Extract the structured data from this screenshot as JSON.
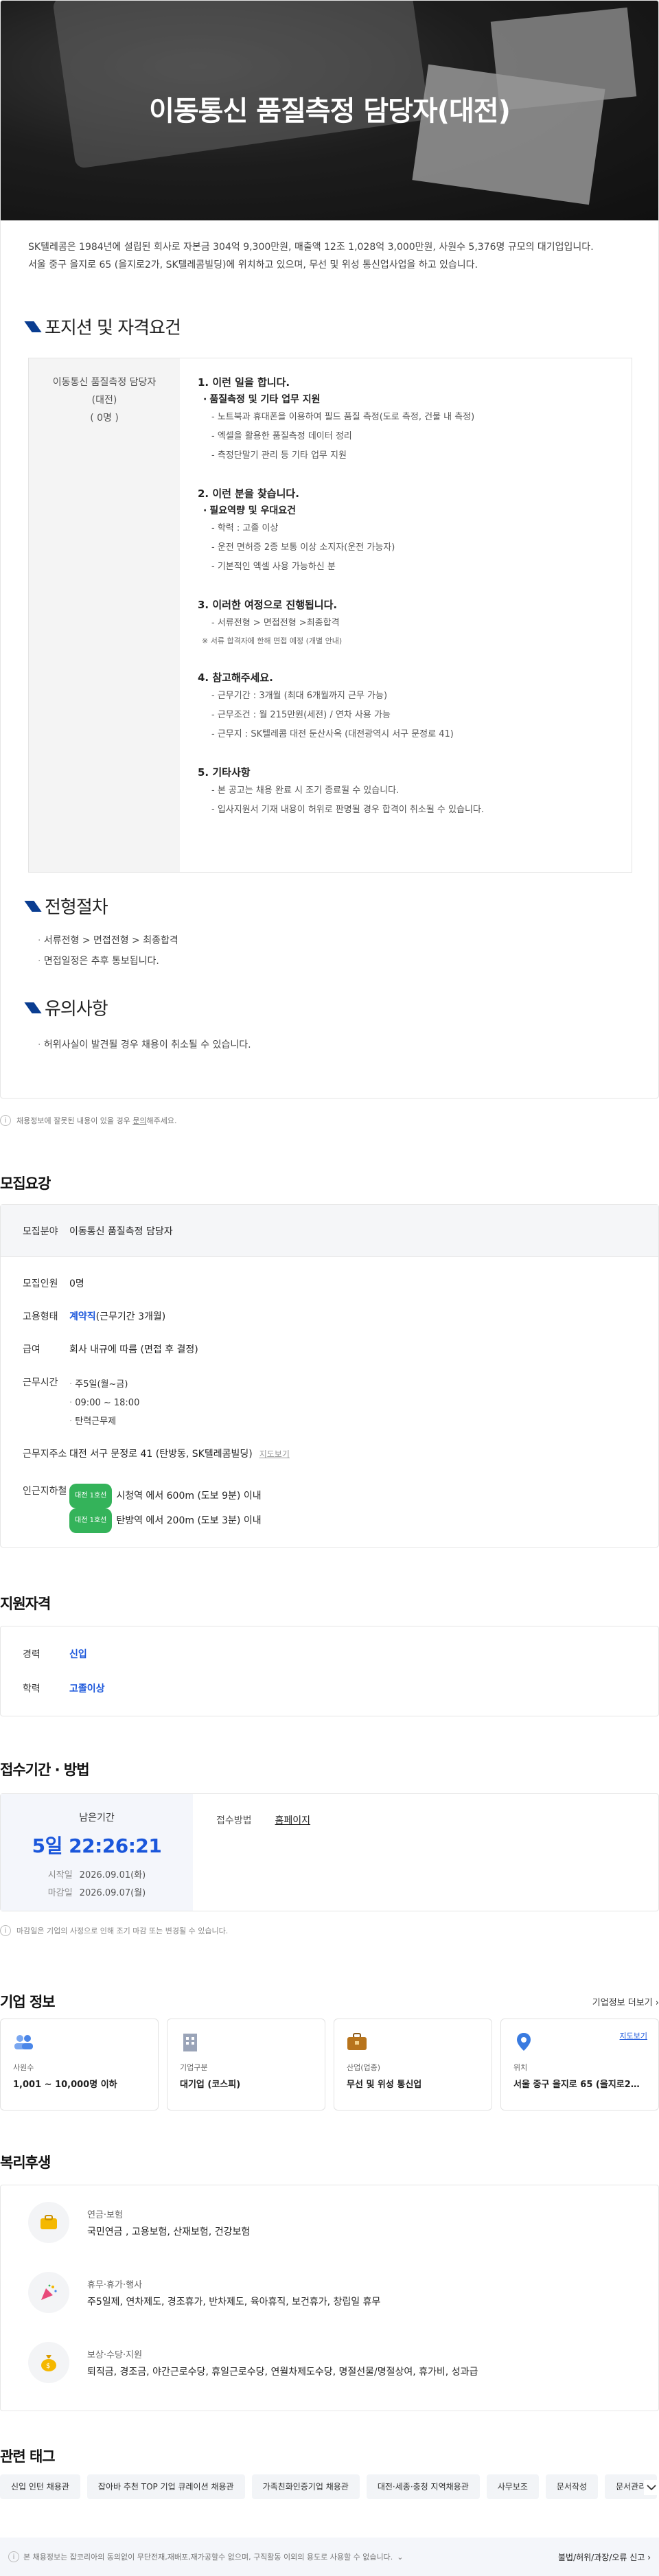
{
  "hero": {
    "title": "이동통신 품질측정 담당자(대전)"
  },
  "intro": {
    "line1": "SK텔레콤은 1984년에 설립된 회사로 자본금 304억 9,300만원, 매출액 12조 1,028억 3,000만원, 사원수 5,376명 규모의 대기업입니다.",
    "line2": "서울 중구 을지로 65 (을지로2가, SK텔레콤빌딩)에 위치하고 있으며, 무선 및 위성 통신업사업을 하고 있습니다."
  },
  "position": {
    "heading": "포지션 및 자격요건",
    "left": {
      "name": "이동통신 품질측정 담당자",
      "region": "(대전)",
      "count": "( 0명 )"
    },
    "blocks": [
      {
        "title": "1. 이런 일을 합니다.",
        "sub": "품질측정 및 기타 업무 지원",
        "items": [
          "노트북과 휴대폰을 이용하여 필드 품질 측정(도로 측정, 건물 내 측정)",
          "엑셀을 활용한 품질측정 데이터 정리",
          "측정단말기 관리 등 기타 업무 지원"
        ]
      },
      {
        "title": "2. 이런 분을 찾습니다.",
        "sub": "필요역량 및 우대요건",
        "items": [
          "학력 : 고졸 이상",
          "운전 면허증 2종 보통 이상 소지자(운전 가능자)",
          "기본적인 엑셀 사용 가능하신 분"
        ]
      },
      {
        "title": "3. 이러한 여정으로 진행됩니다.",
        "items": [
          "서류전형 > 면접전형 >최종합격"
        ],
        "note": "※ 서류 합격자에 한해 면접 예정 (개별 안내)"
      },
      {
        "title": "4. 참고해주세요.",
        "items": [
          "근무기간 : 3개월 (최대 6개월까지 근무 가능)",
          "근무조건 : 월 215만원(세전) / 연차 사용 가능",
          "근무지 : SK텔레콤 대전 둔산사옥 (대전광역시 서구 문정로 41)"
        ]
      },
      {
        "title": "5. 기타사항",
        "items": [
          "본 공고는 채용 완료 시 조기 종료될 수 있습니다.",
          "입사지원서 기재 내용이 허위로 판명될 경우 합격이 취소될 수 있습니다."
        ]
      }
    ]
  },
  "process": {
    "heading": "전형절차",
    "lines": [
      "서류전형 > 면접전형 > 최종합격",
      "면접일정은 추후 통보됩니다."
    ]
  },
  "caution": {
    "heading": "유의사항",
    "lines": [
      "허위사실이 발견될 경우 채용이 취소될 수 있습니다."
    ]
  },
  "notice": {
    "text_before": "채용정보에 잘못된 내용이 있을 경우 ",
    "link": "문의",
    "text_after": "해주세요."
  },
  "recruit": {
    "heading": "모집요강",
    "field_label": "모집분야",
    "field_value": "이동통신 품질측정 담당자",
    "count_label": "모집인원",
    "count_value": "0명",
    "type_label": "고용형태",
    "type_value": "계약직",
    "type_extra": "(근무기간 3개월)",
    "pay_label": "급여",
    "pay_value": "회사 내규에 따름 (면접 후 결정)",
    "time_label": "근무시간",
    "time_items": [
      "주5일(월~금)",
      "09:00 ~ 18:00",
      "탄력근무제"
    ],
    "addr_label": "근무지주소",
    "addr_value": "대전 서구 문정로 41 (탄방동, SK텔레콤빌딩)",
    "addr_map": "지도보기",
    "subway_label": "인근지하철",
    "subway": [
      {
        "badge": "대전 1호선",
        "text": "시청역 에서 600m (도보 9분) 이내"
      },
      {
        "badge": "대전 1호선",
        "text": "탄방역 에서 200m (도보 3분) 이내"
      }
    ]
  },
  "qual": {
    "heading": "지원자격",
    "career_label": "경력",
    "career_value": "신입",
    "edu_label": "학력",
    "edu_value": "고졸이상"
  },
  "apply": {
    "heading": "접수기간 · 방법",
    "remain_label": "남은기간",
    "remain": "5일 22:26:21",
    "start_label": "시작일",
    "start": "2026.09.01(화)",
    "end_label": "마감일",
    "end": "2026.09.07(월)",
    "method_label": "접수방법",
    "method": "홈페이지",
    "note": "마감일은 기업의 사정으로 인해 조기 마감 또는 변경될 수 있습니다."
  },
  "company": {
    "heading": "기업 정보",
    "more": "기업정보 더보기",
    "cards": [
      {
        "label": "사원수",
        "value": "1,001 ~ 10,000명 이하",
        "icon": "people-icon"
      },
      {
        "label": "기업구분",
        "value": "대기업 (코스피)",
        "icon": "building-icon"
      },
      {
        "label": "산업(업종)",
        "value": "무선 및 위성 통신업",
        "icon": "briefcase-icon"
      },
      {
        "label": "위치",
        "value": "서울 중구 을지로 65 (을지로2가...",
        "icon": "pin-icon",
        "map": "지도보기"
      }
    ]
  },
  "welfare": {
    "heading": "복리후생",
    "rows": [
      {
        "label": "연금·보험",
        "value": "국민연금 , 고용보험, 산재보험, 건강보험"
      },
      {
        "label": "휴무·휴가·행사",
        "value": "주5일제, 연차제도, 경조휴가, 반차제도, 육아휴직, 보건휴가, 창립일 휴무"
      },
      {
        "label": "보상·수당·지원",
        "value": "퇴직금, 경조금, 야간근로수당, 휴일근로수당, 연월차제도수당, 명절선물/명절상여, 휴가비, 성과급"
      }
    ]
  },
  "tags": {
    "heading": "관련 태그",
    "items": [
      "신입 인턴 채용관",
      "잡아바 추천 TOP 기업 큐레이션 채용관",
      "가족친화인증기업 채용관",
      "대전·세종·충청 지역채용관",
      "사무보조",
      "문서작성",
      "문서관리"
    ]
  },
  "footer": {
    "left": "본 채용정보는 잡코리아의 동의없이 무단전재,재배포,재가공할수 없으며, 구직활동 이외의 용도로 사용할 수 없습니다.",
    "right": "불법/허위/과장/오류 신고"
  },
  "colors": {
    "accent": "#1a56db",
    "navy": "#0a3d91",
    "green": "#34b35a"
  }
}
